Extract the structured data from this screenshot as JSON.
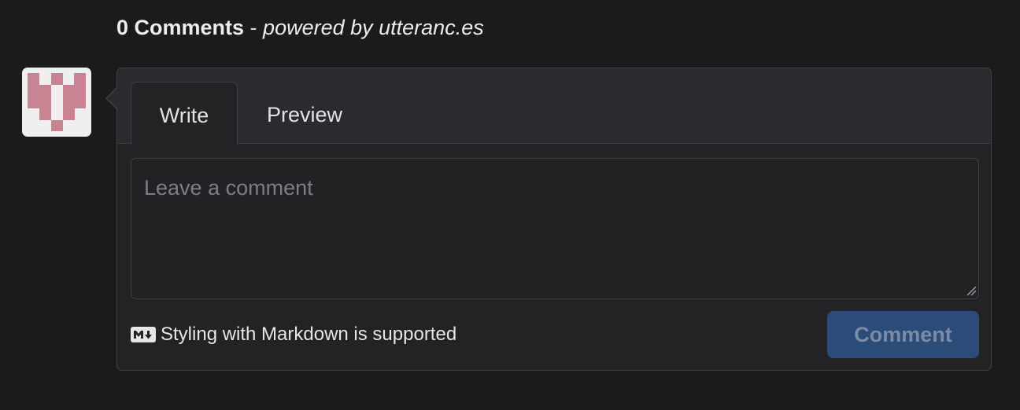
{
  "header": {
    "count_label": "0 Comments",
    "separator": " - ",
    "powered_label": "powered by utteranc.es"
  },
  "avatar": {
    "icon": "identicon-avatar",
    "color": "#c98493"
  },
  "tabs": [
    {
      "label": "Write",
      "selected": true
    },
    {
      "label": "Preview",
      "selected": false
    }
  ],
  "editor": {
    "value": "",
    "placeholder": "Leave a comment"
  },
  "footer": {
    "markdown_icon": "markdown-icon",
    "markdown_note": "Styling with Markdown is supported",
    "comment_label": "Comment"
  },
  "colors": {
    "background": "#1b1b1c",
    "panel": "#232326",
    "tabbar": "#2b2b2f",
    "border": "#3f4045",
    "button": "#2b4b78"
  }
}
